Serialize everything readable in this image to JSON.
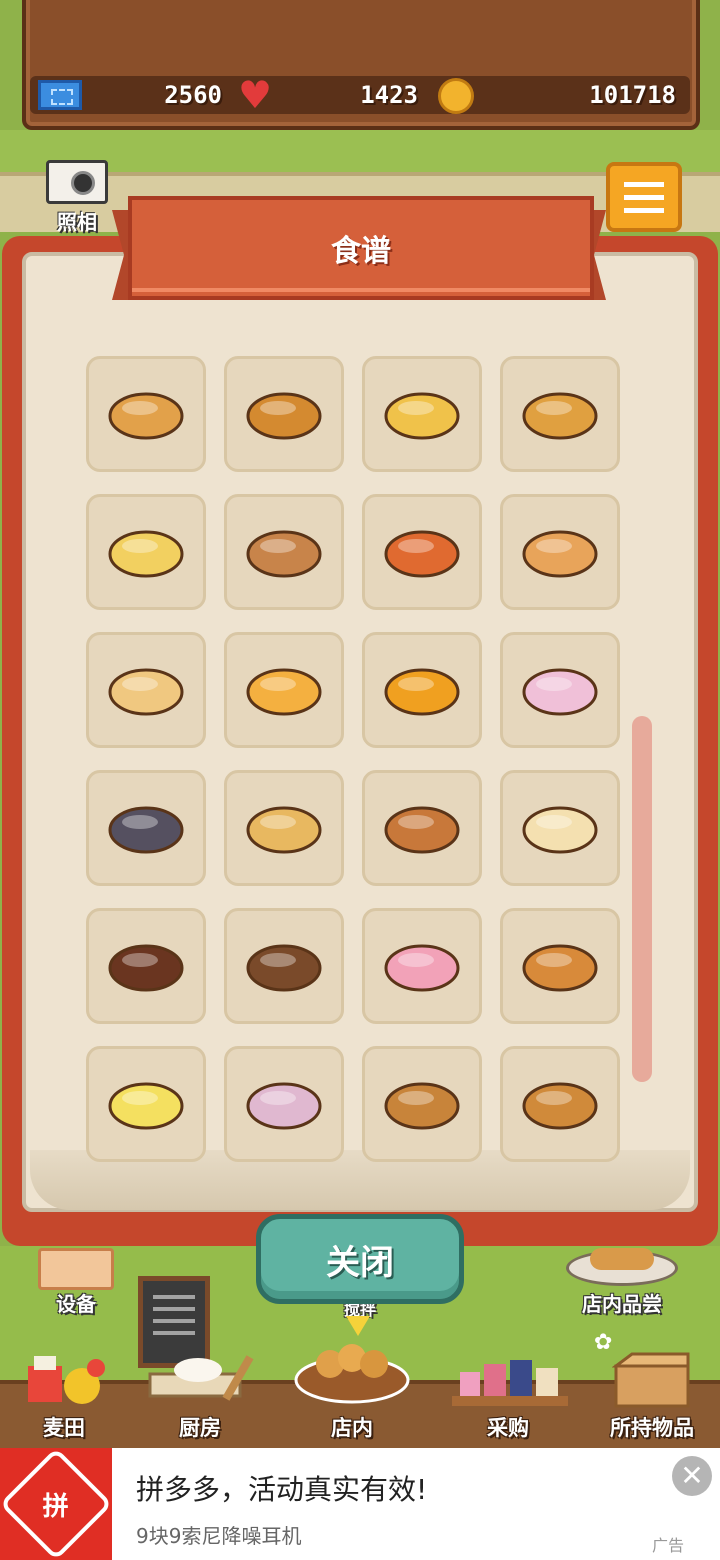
{
  "resources": {
    "tickets": "2560",
    "hearts": "1423",
    "coins": "101718"
  },
  "camera": {
    "label": "照相"
  },
  "recipe_book": {
    "title": "食谱",
    "close_label": "关闭",
    "items": [
      {
        "name": "waffle",
        "color": "#e2a14a"
      },
      {
        "name": "baguette",
        "color": "#d48a30"
      },
      {
        "name": "melon-bread",
        "color": "#f0c24a"
      },
      {
        "name": "cream-pastry",
        "color": "#e0a040"
      },
      {
        "name": "cheese-bun",
        "color": "#f2d060"
      },
      {
        "name": "round-loaf",
        "color": "#c8844a"
      },
      {
        "name": "pizza-bread",
        "color": "#e06a30"
      },
      {
        "name": "kouglof",
        "color": "#e8a45a"
      },
      {
        "name": "sandwich-stack",
        "color": "#f0c880"
      },
      {
        "name": "chick-bun",
        "color": "#f4b040"
      },
      {
        "name": "pumpkin-bread",
        "color": "#f0a020"
      },
      {
        "name": "pink-ghost-bun",
        "color": "#f0c0d8"
      },
      {
        "name": "black-cat-bun",
        "color": "#555060"
      },
      {
        "name": "veggie-bread",
        "color": "#e8b860"
      },
      {
        "name": "reindeer-bun",
        "color": "#c8783a"
      },
      {
        "name": "santa-bun",
        "color": "#f4e0b0"
      },
      {
        "name": "chocolate-cake",
        "color": "#6a3520"
      },
      {
        "name": "chocolate-cornet",
        "color": "#7a4a2a"
      },
      {
        "name": "heart-cookie",
        "color": "#f2a2b8"
      },
      {
        "name": "taiyaki",
        "color": "#d88a3a"
      },
      {
        "name": "lemon-tart",
        "color": "#f4e060"
      },
      {
        "name": "rainbow-bread",
        "color": "#e0b8d0"
      },
      {
        "name": "acorn-bread",
        "color": "#c8843a"
      },
      {
        "name": "pie",
        "color": "#d08a3a"
      }
    ]
  },
  "scene": {
    "equipment_label": "设备",
    "tasting_label": "店内品尝",
    "hidden_label": "搅拌"
  },
  "nav": [
    {
      "label": "麦田"
    },
    {
      "label": "厨房"
    },
    {
      "label": "店内"
    },
    {
      "label": "采购"
    },
    {
      "label": "所持物品"
    }
  ],
  "ad": {
    "logo_text": "拼",
    "title": "拼多多，活动真实有效!",
    "subtitle": "9块9索尼降噪耳机",
    "tag": "广告",
    "close_symbol": "✕"
  }
}
